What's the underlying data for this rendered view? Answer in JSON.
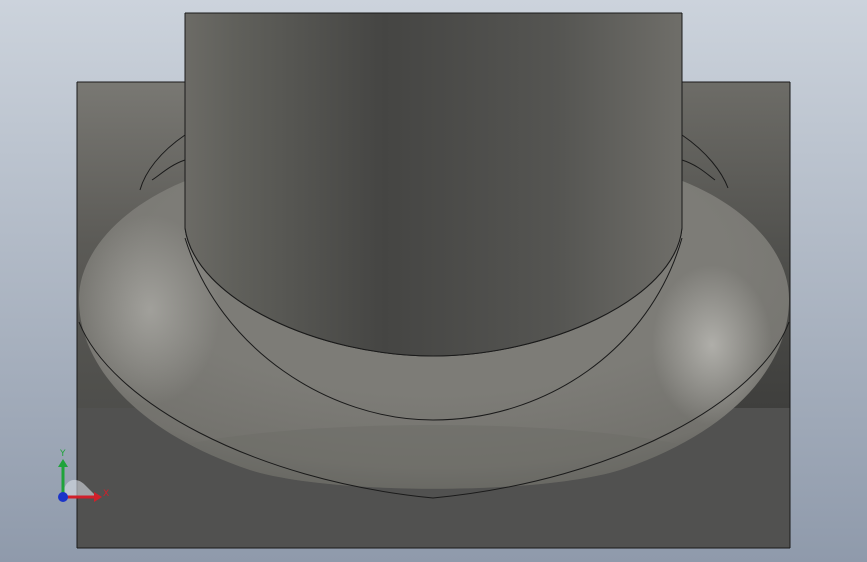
{
  "viewport": {
    "background_top": "#ccd3dc",
    "background_bottom": "#8f9aab"
  },
  "model": {
    "body_color": "#5e5d59",
    "edge_color": "#1a1a1a"
  },
  "triad": {
    "x_label": "X",
    "y_label": "Y",
    "x_color": "#d0202a",
    "y_color": "#1fa33a",
    "z_color": "#1b34c8"
  }
}
